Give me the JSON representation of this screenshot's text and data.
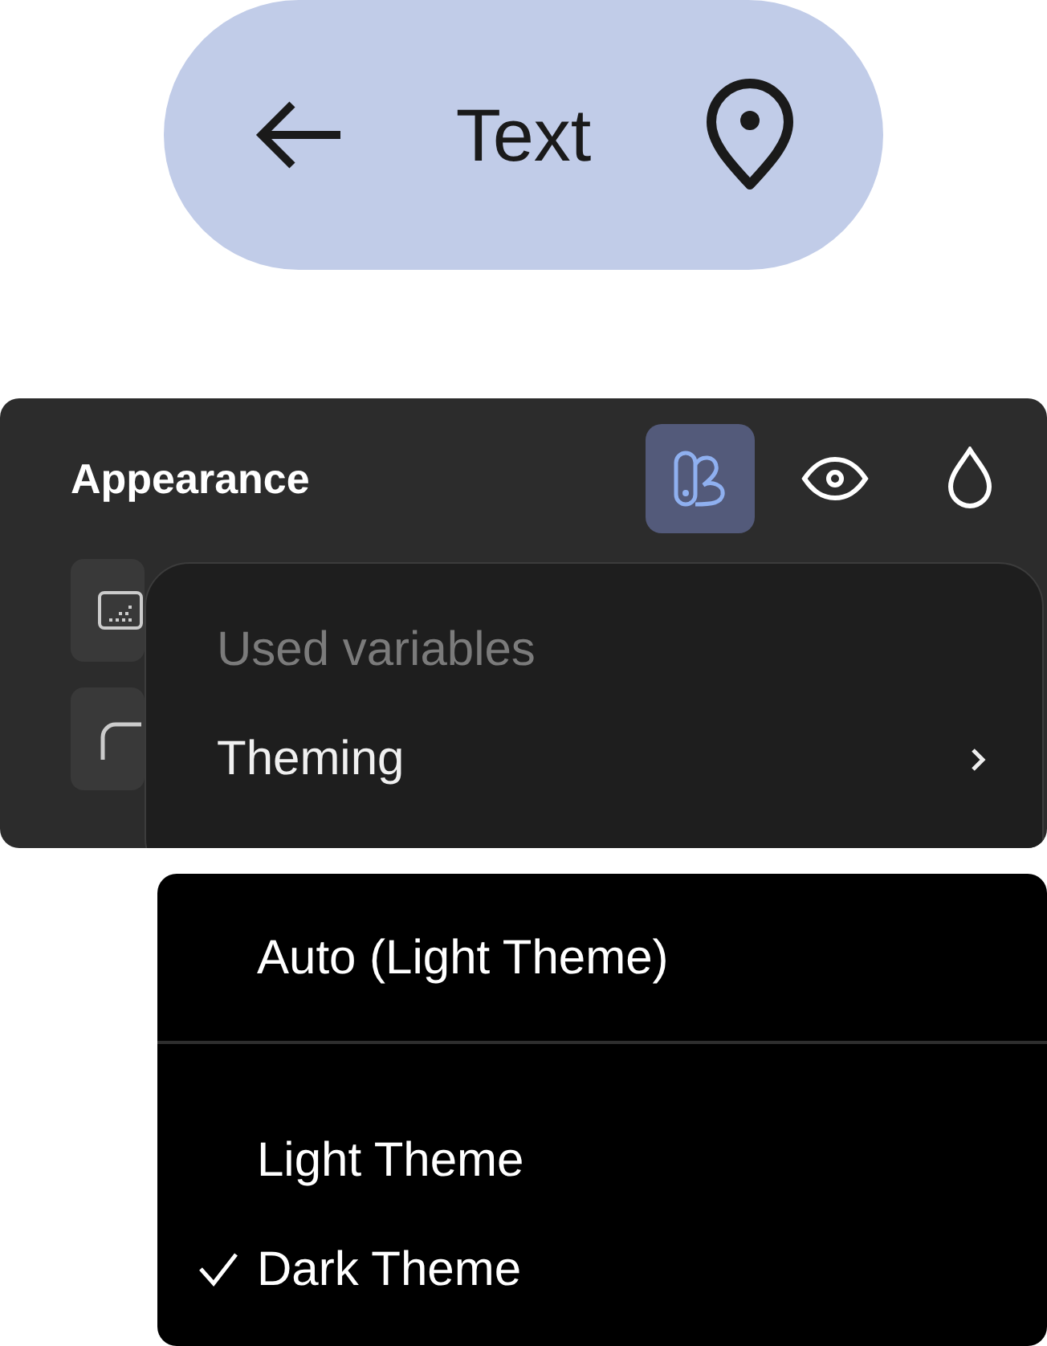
{
  "pill": {
    "title": "Text"
  },
  "appearance": {
    "title": "Appearance",
    "tools": [
      {
        "kind": "theme",
        "selected": true
      },
      {
        "kind": "eye",
        "selected": false
      },
      {
        "kind": "drop",
        "selected": false
      }
    ]
  },
  "popover": {
    "heading": "Used variables",
    "items": [
      {
        "label": "Theming"
      }
    ]
  },
  "theme_menu": {
    "groups": [
      [
        {
          "label": "Auto (Light Theme)",
          "checked": false
        }
      ],
      [
        {
          "label": "Light Theme",
          "checked": false
        },
        {
          "label": "Dark Theme",
          "checked": true
        }
      ]
    ]
  }
}
